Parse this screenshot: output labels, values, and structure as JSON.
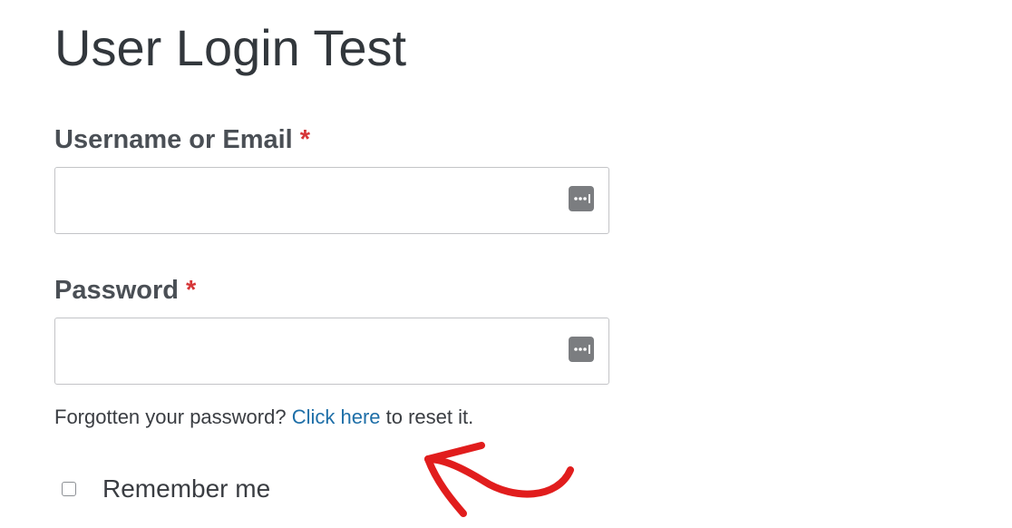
{
  "form": {
    "title": "User Login Test",
    "username": {
      "label": "Username or Email",
      "required_mark": "*",
      "value": "",
      "placeholder": ""
    },
    "password": {
      "label": "Password",
      "required_mark": "*",
      "value": "",
      "placeholder": ""
    },
    "reset": {
      "prefix": "Forgotten your password? ",
      "link_text": "Click here",
      "suffix": " to reset it."
    },
    "remember": {
      "label": "Remember me",
      "checked": false
    }
  },
  "icons": {
    "autofill": "password-manager-icon",
    "annotation": "red-arrow-annotation"
  },
  "colors": {
    "required": "#d63638",
    "link": "#1e6fa8",
    "annotation": "#e11d1d",
    "icon": "#7b7d80"
  }
}
